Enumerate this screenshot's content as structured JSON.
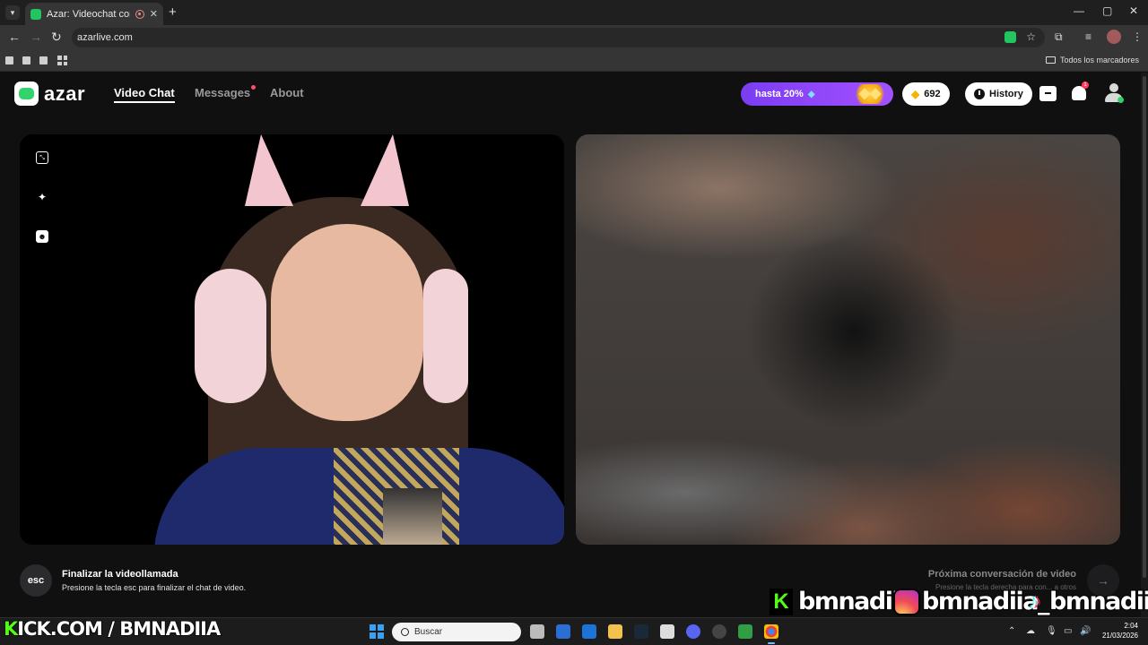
{
  "browser": {
    "tab_title": "Azar: Videochat con gente",
    "tab_close": "✕",
    "new_tab": "+",
    "url": "azarlive.com",
    "all_bookmarks": "Todos los marcadores",
    "window_controls": {
      "minimize": "—",
      "maximize": "▢",
      "close": "✕"
    }
  },
  "site": {
    "logo_text": "azar",
    "nav": [
      {
        "label": "Video Chat",
        "active": true
      },
      {
        "label": "Messages",
        "has_dot": true
      },
      {
        "label": "About"
      }
    ],
    "promo_label": "hasta 20%",
    "gems_count": "692",
    "history_label": "History",
    "notifications_badge": "1"
  },
  "controls": {
    "esc_key": "esc",
    "end_title": "Finalizar la videollamada",
    "end_sub": "Presione la tecla esc para finalizar el chat de video.",
    "next_title": "Próxima conversación de video",
    "next_sub": "Presione la tecla derecha para con... a otros"
  },
  "overlay": {
    "handle_kick": "bmnadiia",
    "handle_instagram": "bmnadiia_",
    "handle_tiktok": "bmnadiia",
    "kick_url_prefix": "K",
    "kick_url": "KICK.COM / BMNADIIA"
  },
  "taskbar": {
    "search_placeholder": "Buscar",
    "time": "2:04",
    "date": "21/03/2026"
  },
  "colors": {
    "brand_green": "#31d36a",
    "promo_purple": "#8a45f7",
    "kick_green": "#53fc18"
  }
}
